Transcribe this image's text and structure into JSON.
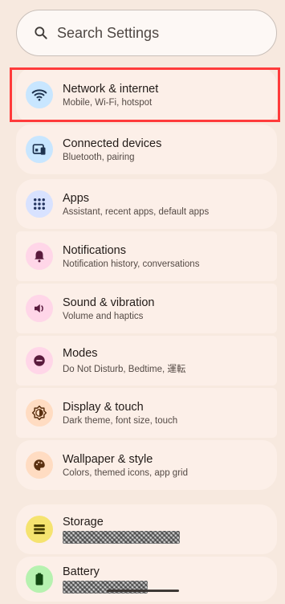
{
  "search": {
    "placeholder": "Search Settings",
    "icon": "search-icon"
  },
  "groups": [
    {
      "items": [
        {
          "title": "Network & internet",
          "subtitle": "Mobile, Wi-Fi, hotspot",
          "icon": "wifi-icon",
          "color": "#c8e6ff"
        },
        {
          "title": "Connected devices",
          "subtitle": "Bluetooth, pairing",
          "icon": "devices-icon",
          "color": "#c8e6ff"
        }
      ]
    },
    {
      "items": [
        {
          "title": "Apps",
          "subtitle": "Assistant, recent apps, default apps",
          "icon": "apps-grid-icon",
          "color": "#d8e2ff"
        },
        {
          "title": "Notifications",
          "subtitle": "Notification history, conversations",
          "icon": "bell-icon",
          "color": "#ffd6e8"
        },
        {
          "title": "Sound & vibration",
          "subtitle": "Volume and haptics",
          "icon": "volume-icon",
          "color": "#ffd6e8"
        },
        {
          "title": "Modes",
          "subtitle": "Do Not Disturb, Bedtime, 運転",
          "icon": "dnd-icon",
          "color": "#ffd6e8"
        },
        {
          "title": "Display & touch",
          "subtitle": "Dark theme, font size, touch",
          "icon": "brightness-icon",
          "color": "#ffdcc2"
        },
        {
          "title": "Wallpaper & style",
          "subtitle": "Colors, themed icons, app grid",
          "icon": "palette-icon",
          "color": "#ffdcc2"
        }
      ]
    },
    {
      "items": [
        {
          "title": "Storage",
          "icon": "storage-icon",
          "color": "#f5e36f"
        },
        {
          "title": "Battery",
          "icon": "battery-icon",
          "color": "#b6f2b0"
        }
      ]
    }
  ]
}
